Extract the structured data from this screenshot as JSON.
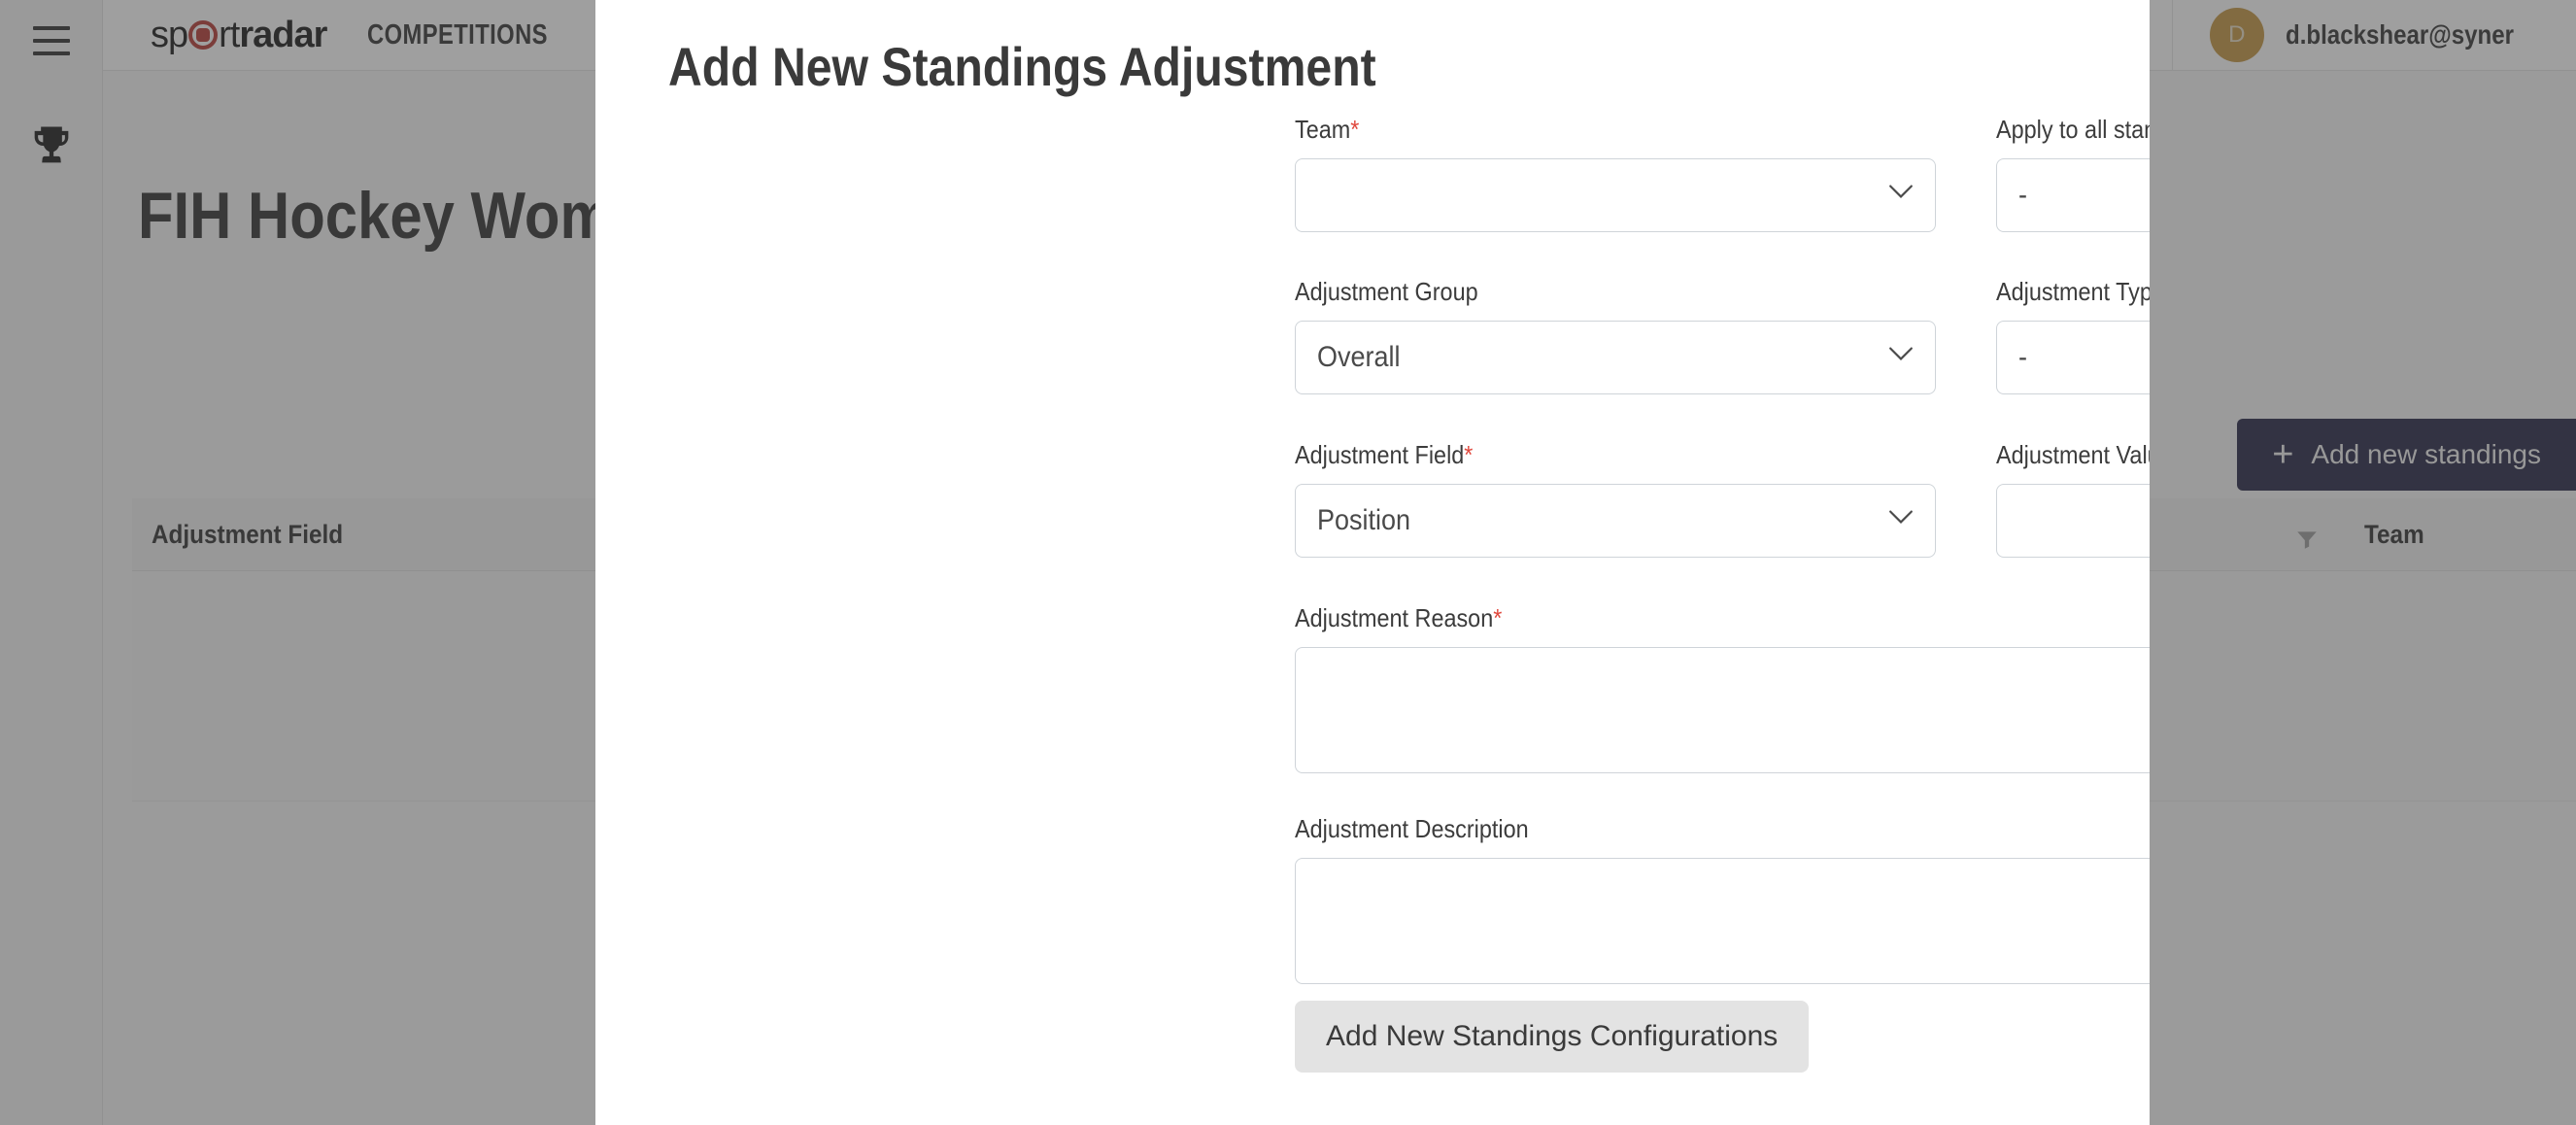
{
  "app": {
    "brand_pre": "sp",
    "brand_post": "rt",
    "brand_bold": "radar",
    "nav": [
      {
        "label": "COMPETITIONS"
      }
    ],
    "user_email": "d.blackshear@syner",
    "avatar_initial": "D",
    "icons": {
      "hamburger": "hamburger-icon",
      "trophy": "trophy-icon",
      "flag": "uk-flag-icon",
      "chevron": "chevron-down-icon",
      "filter": "filter-funnel-icon"
    }
  },
  "page": {
    "title": "FIH Hockey Women's World Cup",
    "add_standings_button": "Add new standings",
    "add_standings_plus": "+",
    "table": {
      "columns": [
        "Adjustment Field",
        "Team"
      ]
    }
  },
  "modal": {
    "title": "Add New Standings Adjustment",
    "fields": {
      "team": {
        "label": "Team",
        "required": "*",
        "value": ""
      },
      "apply_all": {
        "label": "Apply to all standings",
        "required": "",
        "value": "-"
      },
      "adjustment_group": {
        "label": "Adjustment Group",
        "required": "",
        "value": "Overall"
      },
      "adjustment_type": {
        "label": "Adjustment Type",
        "required": "*",
        "value": "-"
      },
      "adjustment_field": {
        "label": "Adjustment Field",
        "required": "*",
        "value": "Position"
      },
      "adjustment_value": {
        "label": "Adjustment Value",
        "required": "*",
        "value": "",
        "placeholder": ""
      },
      "adjustment_reason": {
        "label": "Adjustment Reason",
        "required": "*",
        "value": "",
        "placeholder": ""
      },
      "adjustment_description": {
        "label": "Adjustment Description",
        "required": "",
        "value": "",
        "placeholder": ""
      }
    },
    "submit_label": "Add New Standings Configurations"
  },
  "colors": {
    "brand_red": "#b3322c",
    "accent_navy": "#1e1e3f",
    "avatar_gold": "#c3933c",
    "required_red": "#e0483d"
  }
}
